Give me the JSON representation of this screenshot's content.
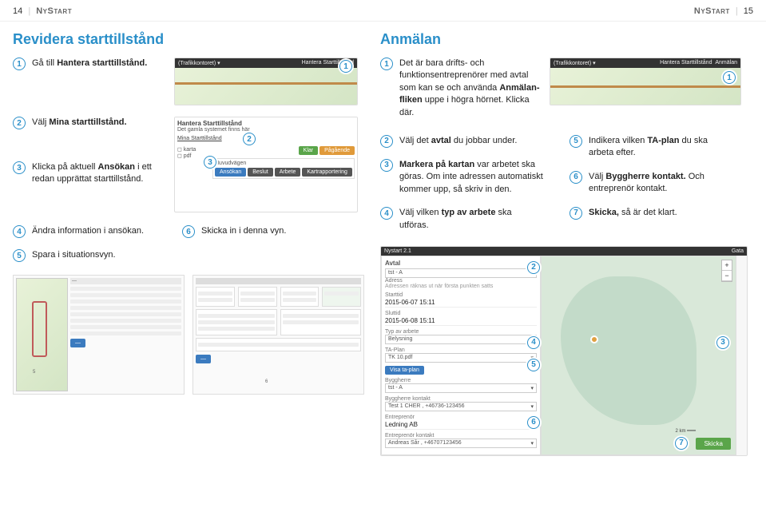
{
  "header": {
    "page_left_num": "14",
    "page_right_num": "15",
    "brand": "NyStart"
  },
  "left": {
    "title": "Revidera starttillstånd",
    "steps": {
      "s1_pre": "Gå till ",
      "s1_bold": "Hantera starttillstånd.",
      "s2_pre": "Välj ",
      "s2_bold": "Mina starttillstånd.",
      "s3_pre": "Klicka på aktuell ",
      "s3_bold": "Ansökan",
      "s3_post": " i ett redan upprättat starttillstånd.",
      "s4": "Ändra information i ansökan.",
      "s5": "Spara i situationsvyn.",
      "s6": "Skicka in i denna vyn."
    },
    "mock1": {
      "bar_left": "(Trafikkontoret) ▾",
      "bar_right": "Hantera Starttillstånd"
    },
    "mock2": {
      "title": "Hantera Starttillstånd",
      "sub": "Det gamla systemet finns här",
      "tab": "Mina Starttillstånd",
      "btn_klar": "Klar",
      "btn_pag": "Pågående",
      "row_label": "Huvudvägen",
      "tabs": [
        "Ansökan",
        "Beslut",
        "Arbete",
        "Kartrapportering"
      ],
      "side_karta": "karta",
      "side_pdf": "pdf"
    }
  },
  "right": {
    "title": "Anmälan",
    "steps": {
      "s1_pre": "Det är bara drifts- och funktionsentreprenörer med avtal som kan se och använda ",
      "s1_bold": "Anmälan-fliken",
      "s1_post": " uppe i högra hörnet. Klicka där.",
      "s2_pre": "Välj det ",
      "s2_bold": "avtal",
      "s2_post": " du jobbar under.",
      "s3_bold1": "Markera på kartan",
      "s3_mid": " var arbetet ska göras. Om inte adressen automatiskt kommer upp, så skriv in den.",
      "s4_pre": "Välj vilken ",
      "s4_bold": "typ av arbete",
      "s4_post": " ska utföras.",
      "s5_pre": "Indikera vilken ",
      "s5_bold": "TA-plan",
      "s5_post": " du ska arbeta efter.",
      "s6_pre": "Välj ",
      "s6_bold": "Byggherre kontakt.",
      "s6_post": " Och entreprenör kontakt.",
      "s7_bold": "Skicka,",
      "s7_post": " så är det klart."
    },
    "mock1": {
      "bar_left": "(Trafikkontoret) ▾",
      "bar_mid": "Hantera Starttillstånd",
      "bar_right": "Anmälan"
    },
    "form": {
      "app_title": "Nystart 2.1",
      "gata_label": "Gata",
      "section": "Avtal",
      "avtal_val": "tst - A",
      "adress_label": "Adress",
      "adress_hint": "Adressen räknas ut när första punkten satts",
      "starttid_label": "Starttid",
      "starttid_val": "2015-06-07 15:11",
      "sluttid_label": "Sluttid",
      "sluttid_val": "2015-06-08 15:11",
      "typ_label": "Typ av arbete",
      "typ_val": "Belysning",
      "taplan_label": "TA-Plan",
      "taplan_val": "TK 10.pdf",
      "visa_btn": "Visa ta-plan",
      "byggherre_label": "Byggherre",
      "byggherre_val": "tst - A",
      "byggherre_kontakt_label": "Byggherre kontakt",
      "byggherre_kontakt_val": "Test 1 CHER , +46736-123456",
      "entreprenor_label": "Entreprenör",
      "entreprenor_val": "Ledning AB",
      "entreprenor_kontakt_label": "Entreprenör kontakt",
      "entreprenor_kontakt_val": "Andreas Sår , +46707123456",
      "skicka_btn": "Skicka",
      "scale": "2 km",
      "zoom_plus": "+",
      "zoom_minus": "−"
    }
  },
  "markers": {
    "m1": "1",
    "m2": "2",
    "m3": "3",
    "m4": "4",
    "m5": "5",
    "m6": "6",
    "m7": "7"
  }
}
